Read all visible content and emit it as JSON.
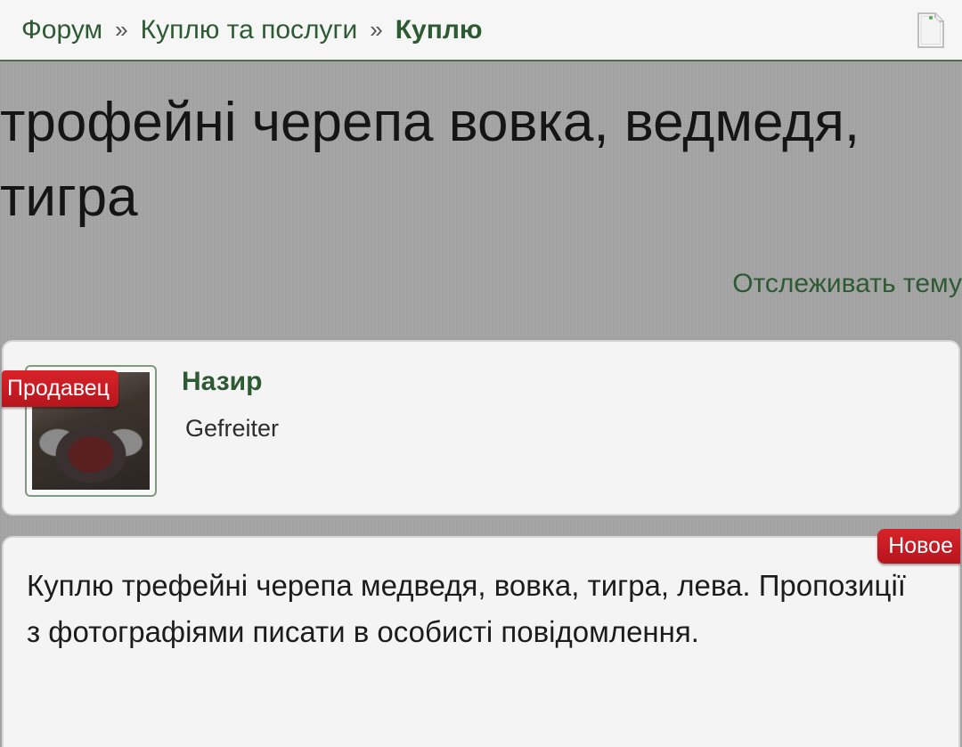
{
  "breadcrumb": {
    "items": [
      "Форум",
      "Куплю та послуги"
    ],
    "separator": "»",
    "current": "Куплю"
  },
  "icons": {
    "page": "document-icon"
  },
  "thread": {
    "title": "трофейні черепа вовка, ведмедя, тигра",
    "watch_label": "Отслеживать тему"
  },
  "author": {
    "name": "Назир",
    "rank": "Gefreiter",
    "badge": "Продавец"
  },
  "post": {
    "badge": "Новое",
    "body": "Куплю трефейні черепа медведя, вовка, тигра, лева. Пропозиції з фотографіями писати в особисті повідомлення."
  },
  "colors": {
    "accent_green": "#2d5a32",
    "badge_red": "#c8161d",
    "background_grey": "#a4a4a4"
  }
}
